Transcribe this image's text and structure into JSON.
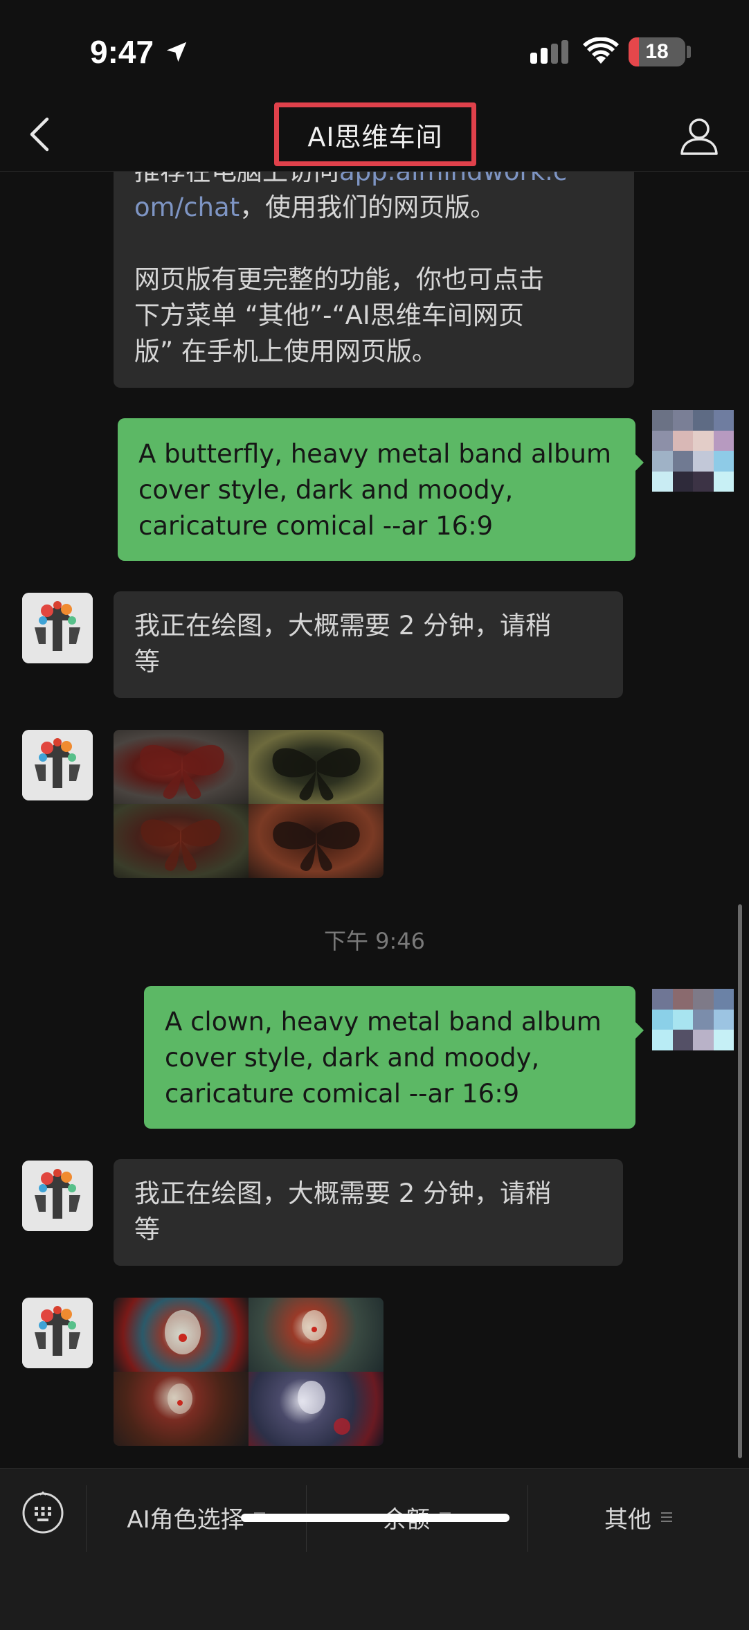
{
  "status_bar": {
    "time": "9:47",
    "battery": "18",
    "battery_level": 0.18
  },
  "nav": {
    "title": "AI思维车间"
  },
  "messages": {
    "m1_line1_prefix": "推荐在电脑上访问",
    "m1_link1": "app.aimindwork.c",
    "m1_link2": "om/chat",
    "m1_line2_suffix": "，使用我们的网页版。",
    "m1_para2": "网页版有更完整的功能，你也可点击\n下方菜单 “其他”-“AI思维车间网页\n版” 在手机上使用网页版。",
    "m2_text": "A butterfly, heavy metal band album\n cover style, dark and moody,\ncaricature comical --ar 16:9",
    "m3_text": "我正在绘图，大概需要 2 分钟，请稍\n等",
    "timestamp": "下午 9:46",
    "m5_text": "A clown, heavy metal band album\ncover style, dark and moody,\ncaricature comical --ar 16:9",
    "m6_text": "我正在绘图，大概需要 2 分钟，请稍\n等"
  },
  "bottom_menu": {
    "item1": "AI角色选择",
    "item2": "余额",
    "item3": "其他"
  },
  "colors": {
    "outgoing_bubble": "#5cb865",
    "incoming_bubble": "#2c2c2c",
    "title_highlight": "#e0414b",
    "link": "#7e95c4"
  },
  "icons": [
    "back-icon",
    "profile-icon",
    "keyboard-icon",
    "location-arrow-icon",
    "signal-icon",
    "wifi-icon",
    "menu-list-icon"
  ]
}
